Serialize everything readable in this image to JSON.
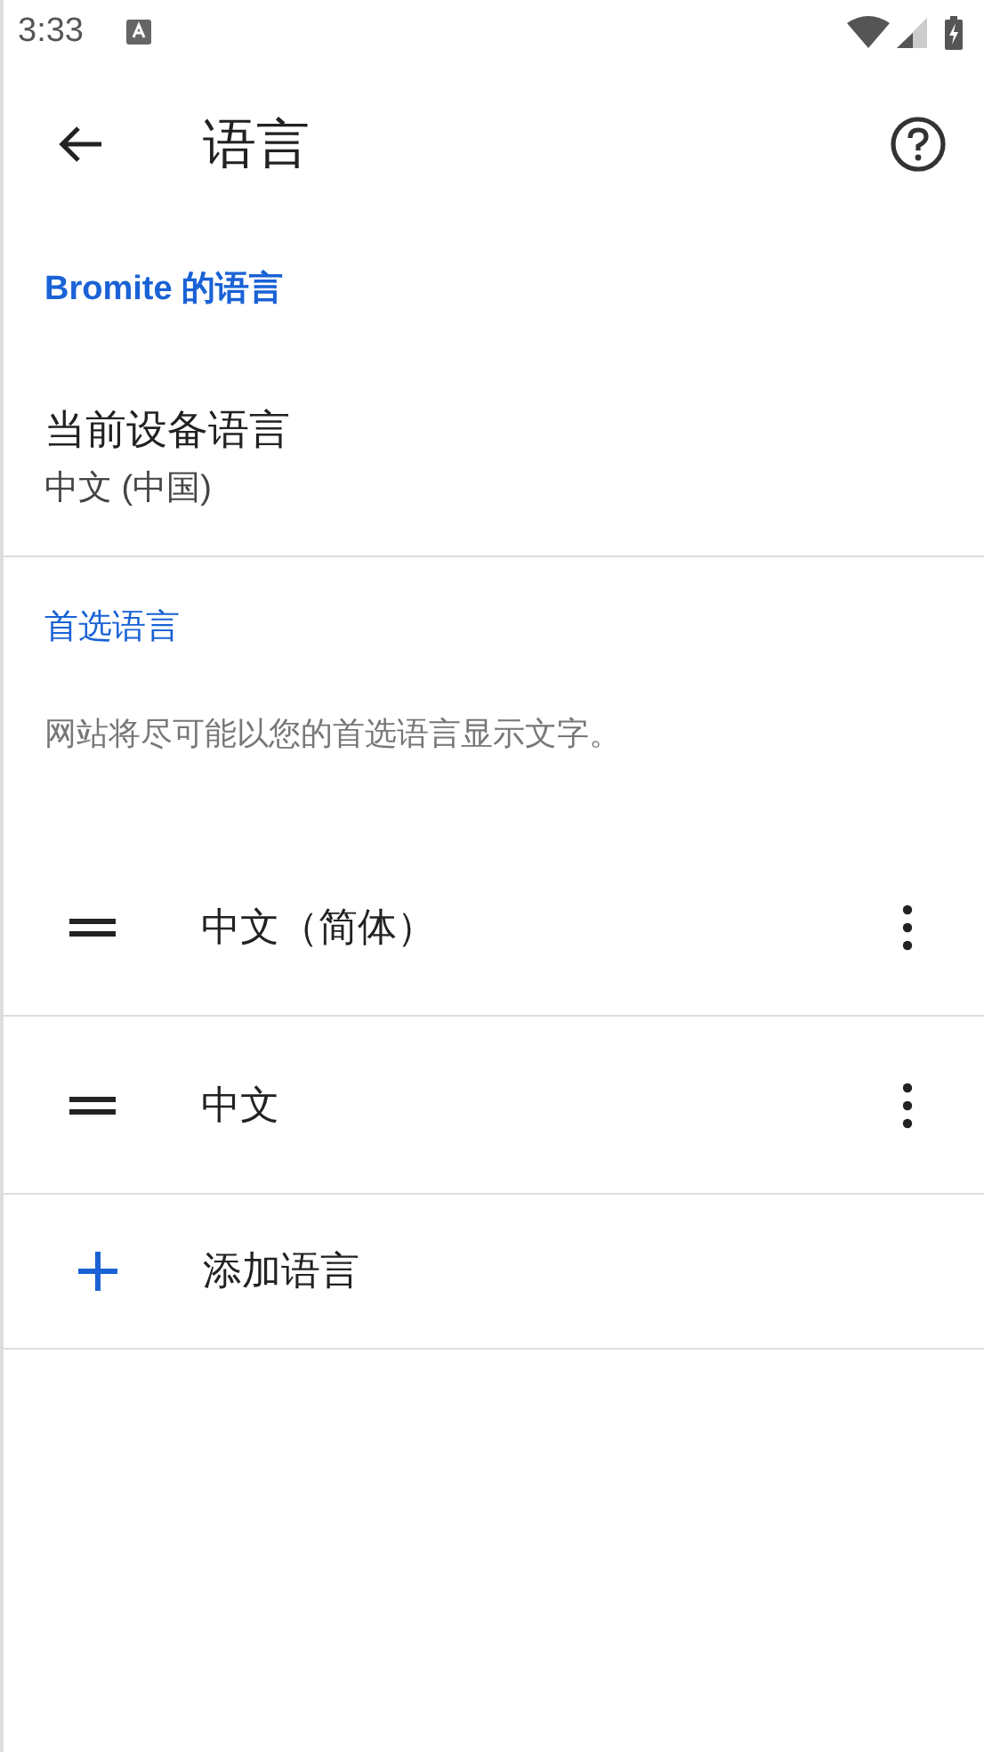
{
  "status_bar": {
    "time": "3:33"
  },
  "app_bar": {
    "title": "语言"
  },
  "browser_section": {
    "header": "Bromite 的语言",
    "device_language": {
      "title": "当前设备语言",
      "value": "中文 (中国)"
    }
  },
  "preferred_section": {
    "header": "首选语言",
    "description": "网站将尽可能以您的首选语言显示文字。",
    "languages": [
      {
        "name": "中文（简体）"
      },
      {
        "name": "中文"
      }
    ],
    "add_button": {
      "label": "添加语言"
    }
  }
}
